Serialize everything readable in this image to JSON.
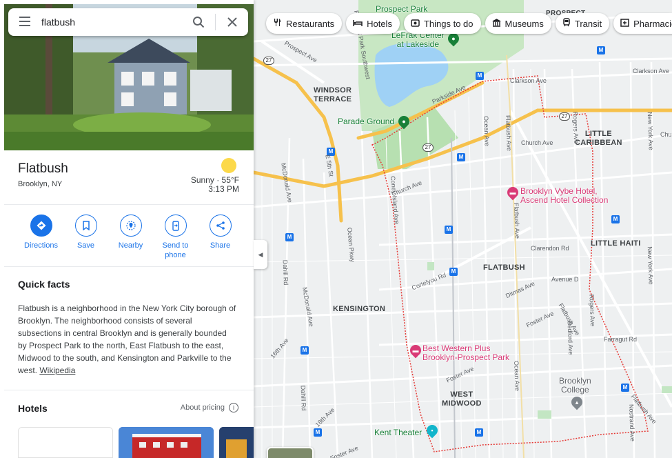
{
  "search": {
    "value": "flatbush",
    "menu_icon": "hamburger-menu-icon",
    "search_icon": "search-icon",
    "close_icon": "close-icon"
  },
  "chips": [
    {
      "label": "Restaurants",
      "icon": "fork-knife-icon"
    },
    {
      "label": "Hotels",
      "icon": "bed-icon"
    },
    {
      "label": "Things to do",
      "icon": "camera-icon"
    },
    {
      "label": "Museums",
      "icon": "museum-icon"
    },
    {
      "label": "Transit",
      "icon": "train-icon"
    },
    {
      "label": "Pharmacies",
      "icon": "pharmacy-icon"
    }
  ],
  "place": {
    "title": "Flatbush",
    "subtitle": "Brooklyn, NY"
  },
  "weather": {
    "condition": "Sunny · 55°F",
    "time": "3:13 PM",
    "icon": "sun-icon"
  },
  "actions": [
    {
      "label": "Directions",
      "icon": "directions-icon"
    },
    {
      "label": "Save",
      "icon": "bookmark-icon"
    },
    {
      "label": "Nearby",
      "icon": "nearby-icon"
    },
    {
      "label": "Send to\nphone",
      "icon": "send-to-phone-icon"
    },
    {
      "label": "Share",
      "icon": "share-icon"
    }
  ],
  "quick_facts": {
    "title": "Quick facts",
    "text": "Flatbush is a neighborhood in the New York City borough of Brooklyn. The neighborhood consists of several subsections in central Brooklyn and is generally bounded by Prospect Park to the north, East Flatbush to the east, Midwood to the south, and Kensington and Parkville to the west. ",
    "link": "Wikipedia"
  },
  "hotels": {
    "title": "Hotels",
    "about_pricing": "About pricing",
    "info_icon": "info-icon"
  },
  "map": {
    "neighborhoods": {
      "windsor_terrace": "WINDSOR\nTERRACE",
      "little_caribbean": "LITTLE\nCARIBBEAN",
      "little_haiti": "LITTLE HAITI",
      "flatbush": "FLATBUSH",
      "kensington": "KENSINGTON",
      "west_midwood": "WEST\nMIDWOOD",
      "prospect_gardens": "PROSPECT\nGA"
    },
    "pois": {
      "prospect_park": "Prospect Park",
      "lefrak": "LeFrak Center\nat Lakeside",
      "parade_ground": "Parade Ground",
      "brooklyn_vybe": "Brooklyn Vybe Hotel,\nAscend Hotel Collection",
      "best_western": "Best Western Plus\nBrooklyn-Prospect Park",
      "kent_theater": "Kent Theater",
      "brooklyn_college": "Brooklyn\nCollege"
    },
    "streets": {
      "prospect_ave": "Prospect Ave",
      "prospect_park_sw": "Prospect Park Southwest",
      "parkside_ave": "Parkside Ave",
      "clarkson_ave": "Clarkson Ave",
      "clarkson_ave2": "Clarkson Ave",
      "church_ave": "Church Ave",
      "church_ave2": "Church Ave",
      "church_ave3": "Chu",
      "e5th": "E 5th St",
      "mcdonald": "McDonald Ave",
      "mcdonald2": "McDonald Ave",
      "coney_island": "Coney Island Ave",
      "ocean_pkwy": "Ocean Pkwy",
      "ocean_ave": "Ocean Ave",
      "ocean_ave2": "Ocean Ave",
      "flatbush_ave": "Flatbush Ave",
      "flatbush_ave2": "Flatbush Ave",
      "flatbush_ave3": "Flatbush Ave",
      "flatbush_ave4": "Flatbush Ave",
      "rogers_ave": "Rogers Ave",
      "rogers_ave2": "Rogers Ave",
      "new_york_ave": "New York Ave",
      "new_york_ave2": "New York Ave",
      "nostrand_ave": "Nostrand Ave",
      "clarendon_rd": "Clarendon Rd",
      "cortelyou_rd": "Cortelyou Rd",
      "avenue_d": "Avenue D",
      "ditmas_ave": "Ditmas Ave",
      "foster_ave": "Foster Ave",
      "foster_ave2": "Foster Ave",
      "foster_ave3": "Foster Ave",
      "bedford_ave": "Bedford Ave",
      "farragut_rd": "Farragut Rd",
      "dahill_rd": "Dahill Rd",
      "dahill_rd2": "Dahill Rd",
      "16th_ave": "16th Ave",
      "18th_ave": "18th Ave"
    },
    "route_shield": "27",
    "subway_badge": "M"
  },
  "colors": {
    "accent": "#1a73e8",
    "poi_pink": "#d93a76",
    "park_green": "#c3e6c3",
    "water": "#aadaff",
    "highway": "#f9c74f",
    "boundary": "#e53935"
  }
}
